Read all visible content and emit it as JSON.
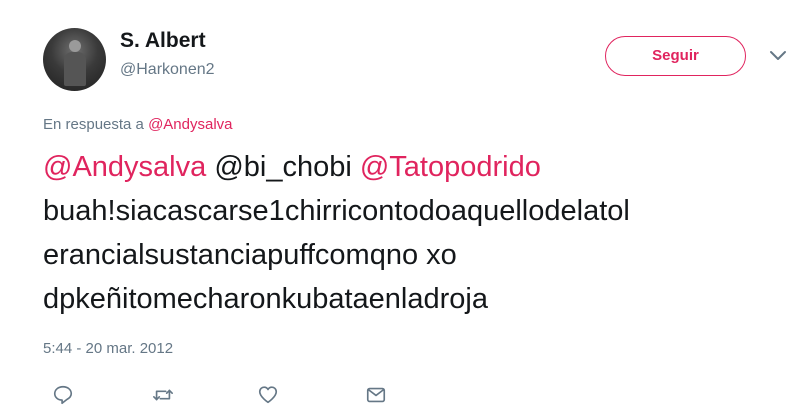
{
  "author": {
    "name": "S. Albert",
    "handle": "@Harkonen2"
  },
  "follow_button": {
    "label": "Seguir"
  },
  "reply_to": {
    "prefix": "En respuesta a",
    "mention": "@Andysalva"
  },
  "tweet": {
    "mention_1": "@Andysalva",
    "mention_2": "@bi_chobi",
    "mention_3": "@Tatopodrido",
    "line_2": "buah!siacascarse1chirricontodoaquellodelatol",
    "line_3": "erancialsustanciapuffcomqno xo",
    "line_4": "dpkeñitomecharonkubataenladroja"
  },
  "timestamp": "5:44 - 20 mar. 2012",
  "actions": [
    {
      "icon": "reply-icon"
    },
    {
      "icon": "retweet-icon"
    },
    {
      "icon": "heart-icon"
    },
    {
      "icon": "envelope-icon"
    }
  ],
  "colors": {
    "accent": "#e0245e",
    "secondary_text": "#657786",
    "primary_text": "#14171a"
  }
}
